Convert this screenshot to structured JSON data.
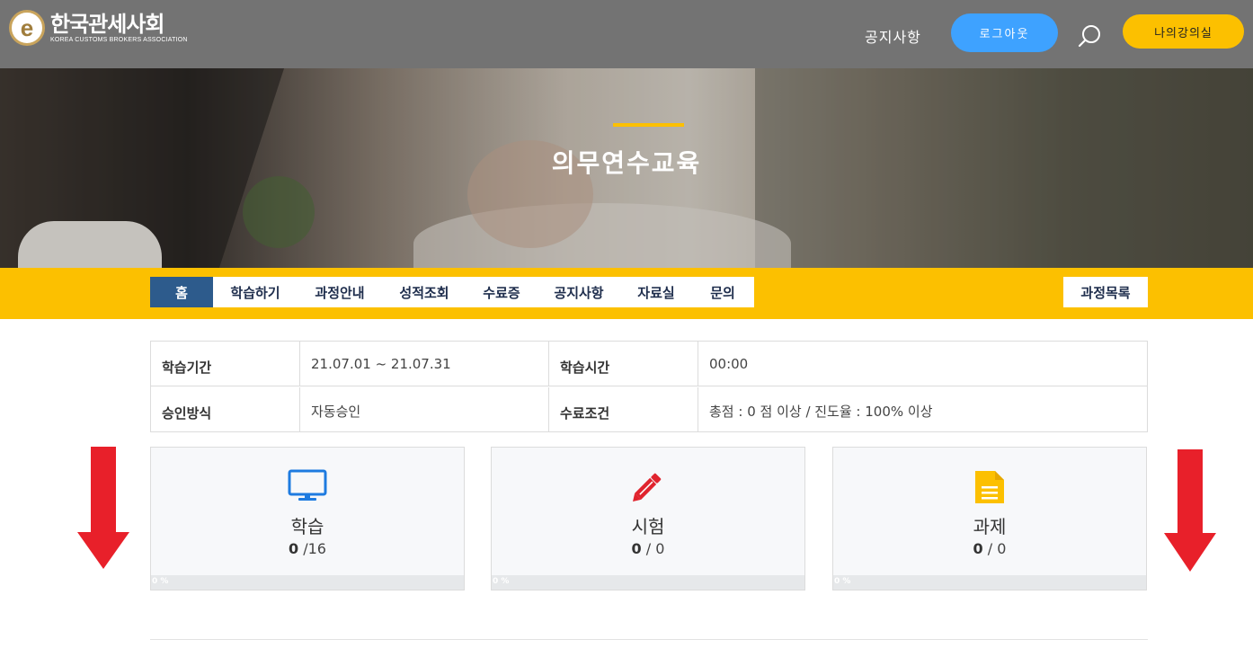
{
  "header": {
    "logo_icon": "e",
    "logo_name": "한국관세사회",
    "logo_subtitle": "KOREA CUSTOMS BROKERS ASSOCIATION",
    "notice_link": "공지사항",
    "logout_button": "로그아웃",
    "search_icon": "search-icon",
    "my_classroom_button": "나의강의실"
  },
  "hero": {
    "title": "의무연수교육"
  },
  "subnav": {
    "tabs": [
      "홈",
      "학습하기",
      "과정안내",
      "성적조회",
      "수료증",
      "공지사항",
      "자료실",
      "문의"
    ],
    "active_tab": "홈",
    "course_list_button": "과정목록"
  },
  "info_table": {
    "rows": [
      {
        "label1": "학습기간",
        "value1": "21.07.01 ~ 21.07.31",
        "label2": "학습시간",
        "value2": "00:00"
      },
      {
        "label1": "승인방식",
        "value1": "자동승인",
        "label2": "수료조건",
        "value2": "총점 : 0 점 이상 / 진도율 : 100% 이상"
      }
    ]
  },
  "cards": [
    {
      "title": "학습",
      "done": "0",
      "total_text": " /16",
      "progress_label": "0 %",
      "progress": 0,
      "icon": "monitor-icon",
      "color": "#1e7be0"
    },
    {
      "title": "시험",
      "done": "0",
      "total_text": " / 0",
      "progress_label": "0 %",
      "progress": 0,
      "icon": "pencil-icon",
      "color": "#e0242e"
    },
    {
      "title": "과제",
      "done": "0",
      "total_text": " / 0",
      "progress_label": "0 %",
      "progress": 0,
      "icon": "document-icon",
      "color": "#fcc000"
    }
  ],
  "colors": {
    "header_bg": "#737373",
    "accent_yellow": "#fcc000",
    "logout_blue": "#3ea2ff",
    "active_tab": "#2d5b8c",
    "arrow_red": "#e8202a"
  }
}
